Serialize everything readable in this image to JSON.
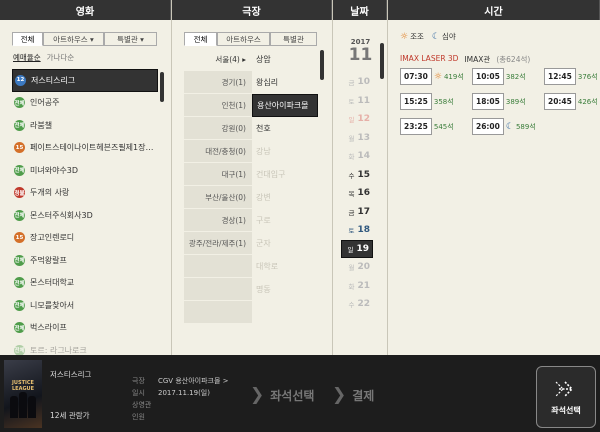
{
  "headers": {
    "movie": "영화",
    "theater": "극장",
    "date": "날짜",
    "time": "시간"
  },
  "movie": {
    "tabs": [
      "전체",
      "아트하우스 ▾",
      "특별관 ▾"
    ],
    "sort": [
      "예매율순",
      "가나다순"
    ],
    "items": [
      {
        "rating": "12",
        "rating_color": "#3c79c0",
        "title": "저스티스리그",
        "selected": true
      },
      {
        "rating": "전체",
        "rating_color": "#4f9c4a",
        "title": "인어공주"
      },
      {
        "rating": "전체",
        "rating_color": "#4f9c4a",
        "title": "라붐챌"
      },
      {
        "rating": "15",
        "rating_color": "#d4702a",
        "title": "페이트스테이나이트헤븐즈필제1장…"
      },
      {
        "rating": "전체",
        "rating_color": "#4f9c4a",
        "title": "미녀와야수3D"
      },
      {
        "rating": "청불",
        "rating_color": "#c0392b",
        "title": "두개의 사랑"
      },
      {
        "rating": "전체",
        "rating_color": "#4f9c4a",
        "title": "몬스터주식회사3D"
      },
      {
        "rating": "15",
        "rating_color": "#d4702a",
        "title": "장고인렌로디"
      },
      {
        "rating": "전체",
        "rating_color": "#4f9c4a",
        "title": "주먹왕랄프"
      },
      {
        "rating": "전체",
        "rating_color": "#4f9c4a",
        "title": "몬스터대학교"
      },
      {
        "rating": "전체",
        "rating_color": "#4f9c4a",
        "title": "니모를찾아서"
      },
      {
        "rating": "전체",
        "rating_color": "#4f9c4a",
        "title": "벅스라이프"
      },
      {
        "rating": "전체",
        "rating_color": "#4f9c4a",
        "title": "토르: 라그나로크",
        "faded": true
      }
    ]
  },
  "theater": {
    "tabs": [
      "전체",
      "아트하우스",
      "특별관"
    ],
    "regions": [
      "서울(4) ▸",
      "경기(1)",
      "인천(1)",
      "강원(0)",
      "대전/충청(0)",
      "대구(1)",
      "부산/울산(0)",
      "경상(1)",
      "광주/전라/제주(1)",
      "",
      "",
      ""
    ],
    "theaters": [
      {
        "name": "상암",
        "state": ""
      },
      {
        "name": "왕십리",
        "state": ""
      },
      {
        "name": "용산아이파크몰",
        "state": "sel"
      },
      {
        "name": "천호",
        "state": ""
      },
      {
        "name": "강남",
        "state": "dim"
      },
      {
        "name": "건대입구",
        "state": "dim"
      },
      {
        "name": "강변",
        "state": "dim"
      },
      {
        "name": "구로",
        "state": "dim"
      },
      {
        "name": "군자",
        "state": "dim"
      },
      {
        "name": "대학로",
        "state": "dim"
      },
      {
        "name": "명동",
        "state": "dim"
      }
    ]
  },
  "date": {
    "year": "2017",
    "month": "11",
    "days": [
      {
        "dow": "금",
        "day": "10",
        "cls": ""
      },
      {
        "dow": "토",
        "day": "11",
        "cls": ""
      },
      {
        "dow": "일",
        "day": "12",
        "cls": "sun dimday"
      },
      {
        "dow": "월",
        "day": "13",
        "cls": ""
      },
      {
        "dow": "화",
        "day": "14",
        "cls": ""
      },
      {
        "dow": "수",
        "day": "15",
        "cls": "active"
      },
      {
        "dow": "목",
        "day": "16",
        "cls": "active"
      },
      {
        "dow": "금",
        "day": "17",
        "cls": "active"
      },
      {
        "dow": "토",
        "day": "18",
        "cls": "active sat"
      },
      {
        "dow": "일",
        "day": "19",
        "cls": "active sel"
      },
      {
        "dow": "월",
        "day": "20",
        "cls": ""
      },
      {
        "dow": "화",
        "day": "21",
        "cls": ""
      },
      {
        "dow": "수",
        "day": "22",
        "cls": ""
      }
    ]
  },
  "time": {
    "legend_morning": "조조",
    "legend_night": "심야",
    "hall_type": "IMAX LASER 3D",
    "hall_name": "IMAX관",
    "hall_seats": "(총624석)",
    "slots": [
      {
        "time": "07:30",
        "seats": "419석",
        "icon": "sun"
      },
      {
        "time": "10:05",
        "seats": "382석",
        "icon": ""
      },
      {
        "time": "12:45",
        "seats": "376석",
        "icon": ""
      },
      {
        "time": "15:25",
        "seats": "358석",
        "icon": ""
      },
      {
        "time": "18:05",
        "seats": "389석",
        "icon": ""
      },
      {
        "time": "20:45",
        "seats": "426석",
        "icon": ""
      },
      {
        "time": "23:25",
        "seats": "545석",
        "icon": ""
      },
      {
        "time": "26:00",
        "seats": "589석",
        "icon": "moon"
      }
    ]
  },
  "summary": {
    "movie_title": "저스티스리그",
    "movie_rating": "12세 관람가",
    "poster_text": "JUSTICE LEAGUE",
    "label_theater": "극장",
    "label_date": "일시",
    "label_hall": "상영관",
    "label_people": "인원",
    "theater_value": "CGV 용산아이파크몰 >",
    "date_value": "2017.11.19(일)",
    "step_seat": "좌석선택",
    "step_pay": "결제",
    "seat_button": "좌석선택"
  }
}
